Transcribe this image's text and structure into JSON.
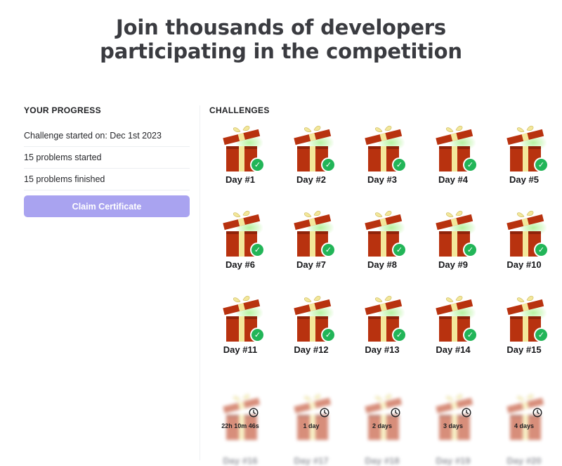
{
  "headline": {
    "line1": "Join thousands of developers",
    "line2": "participating in the competition"
  },
  "progress": {
    "title": "YOUR PROGRESS",
    "started_on": "Challenge started on: Dec 1st 2023",
    "problems_started": "15 problems started",
    "problems_finished": "15 problems finished",
    "claim_label": "Claim Certificate"
  },
  "challenges": {
    "title": "CHALLENGES",
    "days": [
      {
        "label": "Day #1",
        "status": "completed"
      },
      {
        "label": "Day #2",
        "status": "completed"
      },
      {
        "label": "Day #3",
        "status": "completed"
      },
      {
        "label": "Day #4",
        "status": "completed"
      },
      {
        "label": "Day #5",
        "status": "completed"
      },
      {
        "label": "Day #6",
        "status": "completed"
      },
      {
        "label": "Day #7",
        "status": "completed"
      },
      {
        "label": "Day #8",
        "status": "completed"
      },
      {
        "label": "Day #9",
        "status": "completed"
      },
      {
        "label": "Day #10",
        "status": "completed"
      },
      {
        "label": "Day #11",
        "status": "completed"
      },
      {
        "label": "Day #12",
        "status": "completed"
      },
      {
        "label": "Day #13",
        "status": "completed"
      },
      {
        "label": "Day #14",
        "status": "completed"
      },
      {
        "label": "Day #15",
        "status": "completed"
      },
      {
        "label": "Day #16",
        "status": "locked",
        "countdown": "22h 10m 46s"
      },
      {
        "label": "Day #17",
        "status": "locked",
        "countdown": "1 day"
      },
      {
        "label": "Day #18",
        "status": "locked",
        "countdown": "2 days"
      },
      {
        "label": "Day #19",
        "status": "locked",
        "countdown": "3 days"
      },
      {
        "label": "Day #20",
        "status": "locked",
        "countdown": "4 days"
      }
    ]
  },
  "colors": {
    "accent": "#a9a3f0",
    "check": "#22b558",
    "gift_red": "#b8320f",
    "ribbon": "#f3e79a"
  },
  "icons": {
    "completed": "check-icon",
    "locked": "clock-icon",
    "tile": "gift-icon"
  }
}
